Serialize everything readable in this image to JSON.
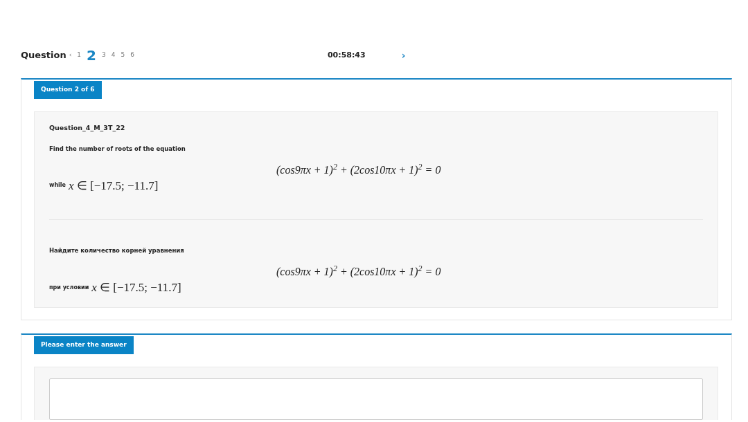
{
  "nav": {
    "label": "Question",
    "prev": "‹",
    "pages": [
      {
        "label": "1",
        "selected": false
      },
      {
        "label": "2",
        "selected": true
      },
      {
        "label": "3",
        "selected": false
      },
      {
        "label": "4",
        "selected": false
      },
      {
        "label": "5",
        "selected": false
      },
      {
        "label": "6",
        "selected": false
      }
    ],
    "timer": "00:58:43",
    "next": "›"
  },
  "question_panel": {
    "tag": "Question 2 of 6",
    "code": "Question_4_M_3T_22",
    "blocks": [
      {
        "prompt": "Find the number of roots of the equation",
        "equation": "(cos9πx + 1)$^{2}$ + (2cos10πx + 1)$^{2}$ = 0",
        "condition_label": "while",
        "condition": "*x* ∈ [−17.5; −11.7]"
      },
      {
        "prompt": "Найдите количество корней уравнения",
        "equation": "(cos9πx + 1)$^{2}$ + (2cos10πx + 1)$^{2}$ = 0",
        "condition_label": "при условии",
        "condition": "*x* ∈ [−17.5; −11.7]"
      }
    ]
  },
  "answer_panel": {
    "tag": "Please enter the answer"
  }
}
